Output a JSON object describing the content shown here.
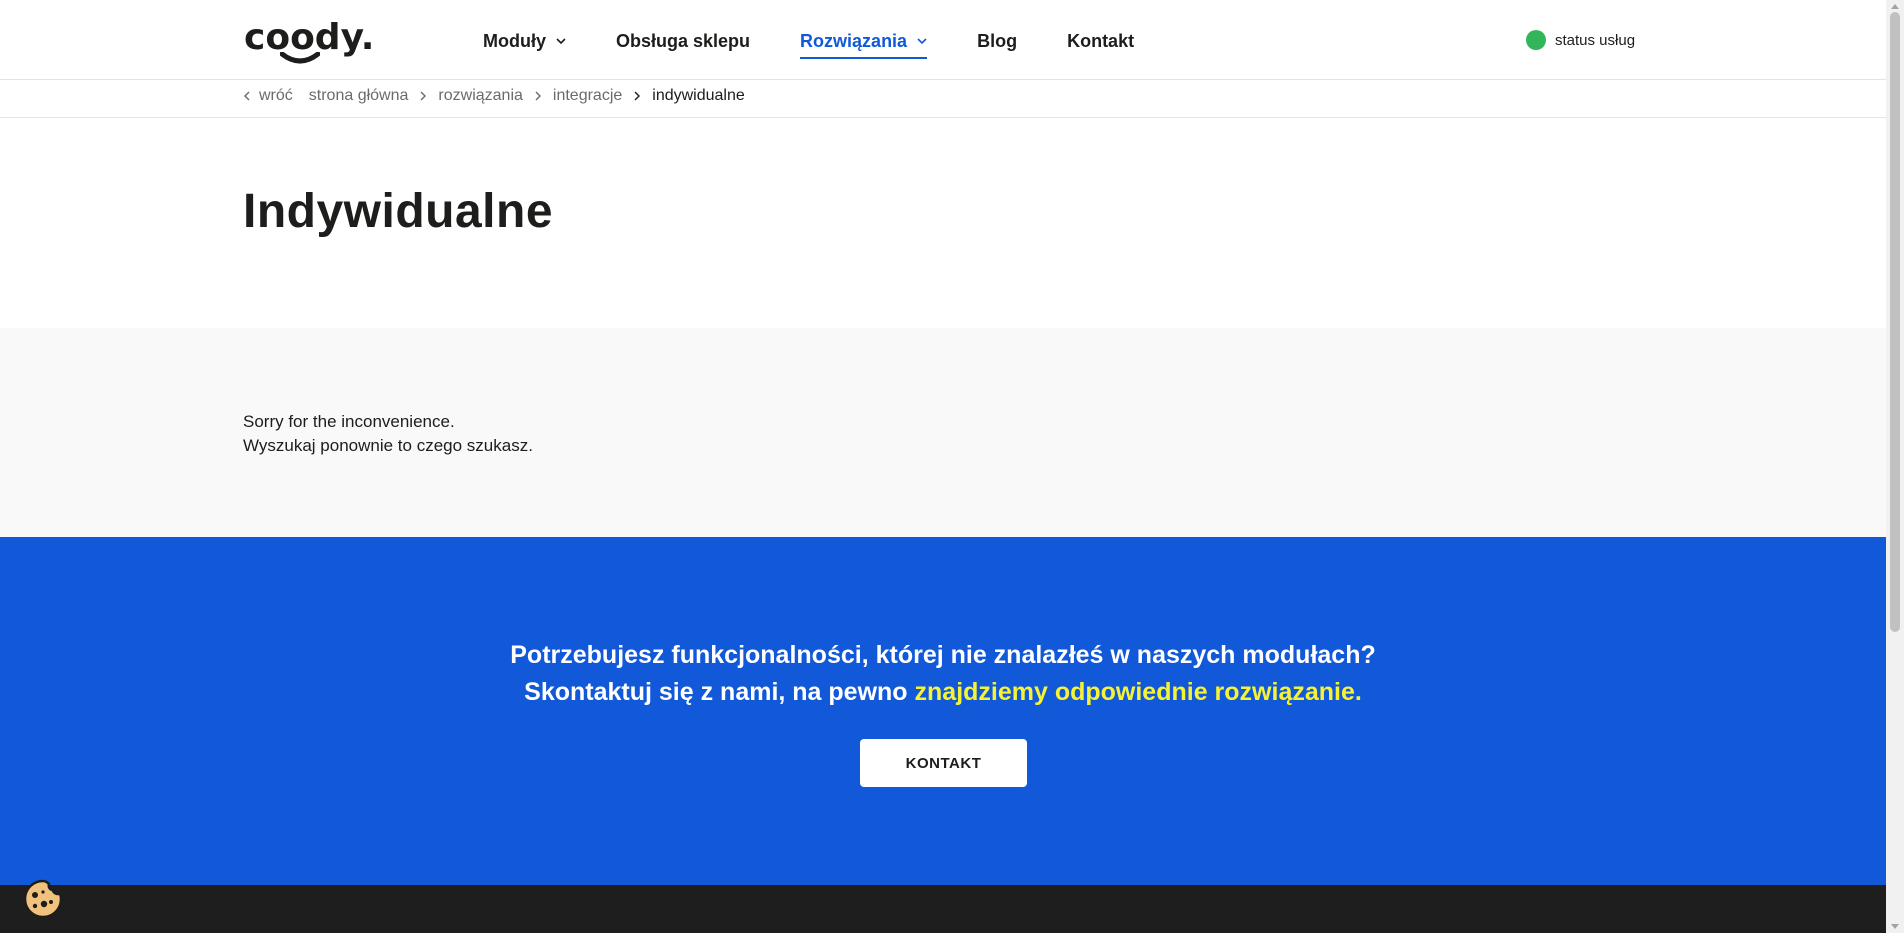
{
  "header": {
    "logo": "coody.",
    "nav": [
      {
        "label": "Moduły",
        "has_dropdown": true
      },
      {
        "label": "Obsługa sklepu",
        "has_dropdown": false
      },
      {
        "label": "Rozwiązania",
        "has_dropdown": true,
        "active": true
      },
      {
        "label": "Blog",
        "has_dropdown": false
      },
      {
        "label": "Kontakt",
        "has_dropdown": false
      }
    ],
    "status_label": "status usług",
    "status_color": "#33b65a"
  },
  "breadcrumb": {
    "back": "wróć",
    "items": [
      "strona główna",
      "rozwiązania",
      "integracje"
    ],
    "current": "indywidualne"
  },
  "page": {
    "title": "Indywidualne",
    "message_line1": "Sorry for the inconvenience.",
    "message_line2": "Wyszukaj ponownie to czego szukasz."
  },
  "cta": {
    "line1": "Potrzebujesz funkcjonalności, której nie znalazłeś w naszych modułach?",
    "line2_prefix": "Skontaktuj się z nami, na pewno ",
    "line2_highlight": "znajdziemy odpowiednie rozwiązanie.",
    "button_label": "KONTAKT",
    "background": "#1159d9",
    "highlight_color": "#f6f236"
  },
  "icons": {
    "cookie": "cookie-icon",
    "dropdown": "chevron-down-icon",
    "breadcrumb_separator": "chevron-right-icon",
    "back": "chevron-left-icon"
  }
}
